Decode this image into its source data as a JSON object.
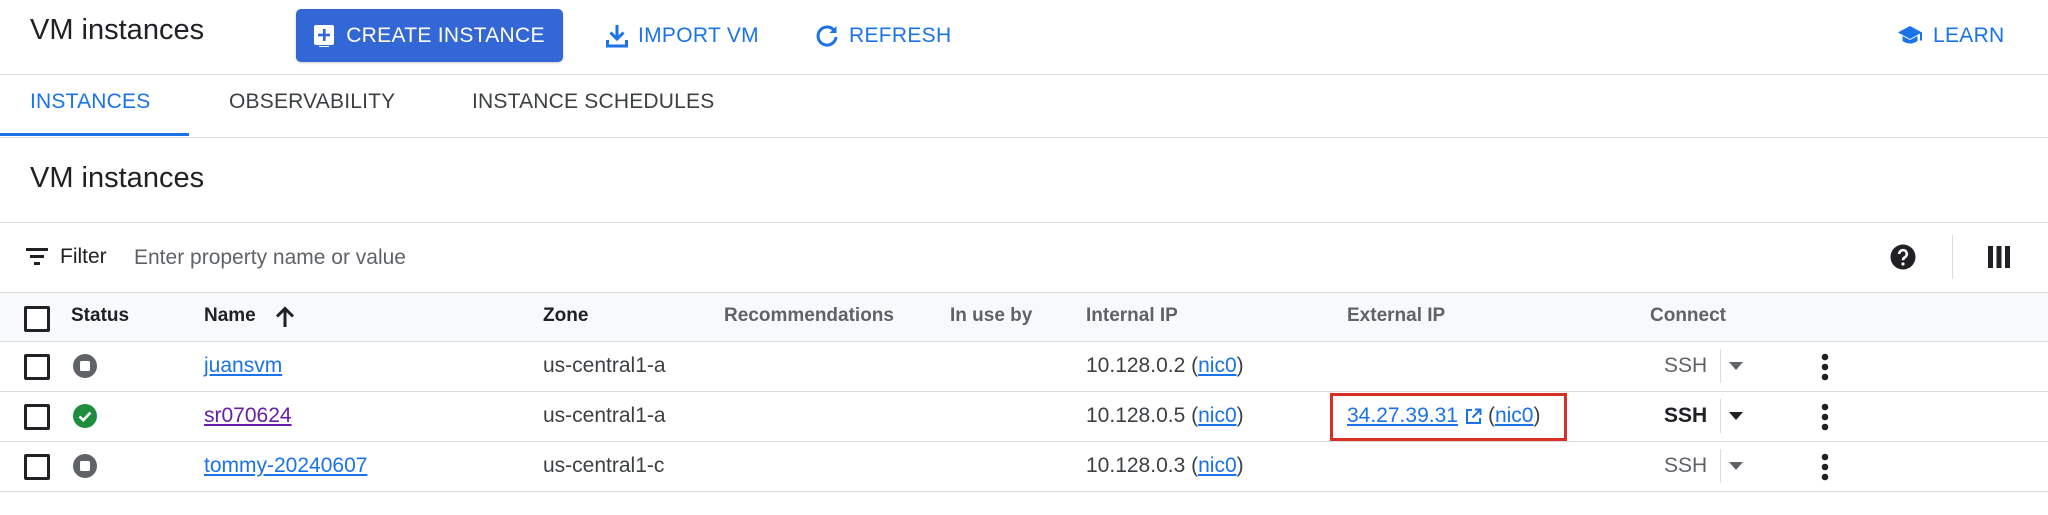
{
  "header": {
    "title": "VM instances",
    "create_label": "CREATE INSTANCE",
    "import_label": "IMPORT VM",
    "refresh_label": "REFRESH",
    "learn_label": "LEARN"
  },
  "tabs": [
    {
      "label": "INSTANCES",
      "active": true
    },
    {
      "label": "OBSERVABILITY",
      "active": false
    },
    {
      "label": "INSTANCE SCHEDULES",
      "active": false
    }
  ],
  "section_title": "VM instances",
  "filter": {
    "label": "Filter",
    "placeholder": "Enter property name or value"
  },
  "columns": {
    "status": "Status",
    "name": "Name",
    "zone": "Zone",
    "recommendations": "Recommendations",
    "in_use_by": "In use by",
    "internal_ip": "Internal IP",
    "external_ip": "External IP",
    "connect": "Connect"
  },
  "rows": [
    {
      "name": "juansvm",
      "status": "stopped",
      "zone": "us-central1-a",
      "internal_ip": "10.128.0.2",
      "internal_nic": "nic0",
      "external_ip": "",
      "external_nic": "",
      "connect": "SSH"
    },
    {
      "name": "sr070624",
      "status": "running",
      "zone": "us-central1-a",
      "internal_ip": "10.128.0.5",
      "internal_nic": "nic0",
      "external_ip": "34.27.39.31",
      "external_nic": "nic0",
      "connect": "SSH"
    },
    {
      "name": "tommy-20240607",
      "status": "stopped",
      "zone": "us-central1-c",
      "internal_ip": "10.128.0.3",
      "internal_nic": "nic0",
      "external_ip": "",
      "external_nic": "",
      "connect": "SSH"
    }
  ],
  "colors": {
    "accent": "#1a73e8",
    "primary_button": "#3367d6",
    "running": "#1e8e3e",
    "stopped": "#5f6368",
    "highlight": "#d93025",
    "visited_link": "#681da8"
  }
}
